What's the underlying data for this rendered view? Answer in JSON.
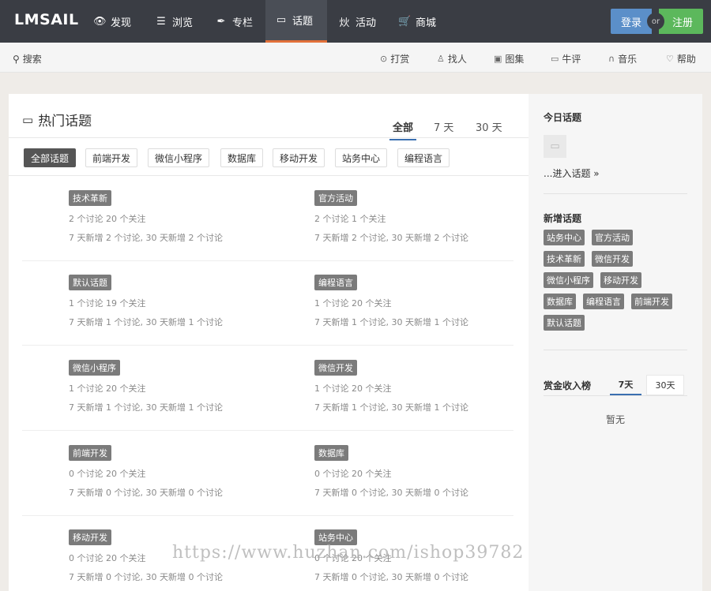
{
  "brand": "LMSAIL",
  "nav": [
    {
      "label": "发现",
      "icon": "eye-icon",
      "glyph": "👁"
    },
    {
      "label": "浏览",
      "icon": "list-icon",
      "glyph": "☰"
    },
    {
      "label": "专栏",
      "icon": "feather-icon",
      "glyph": "✒"
    },
    {
      "label": "话题",
      "icon": "chat-bubble-icon",
      "glyph": "🗨"
    },
    {
      "label": "活动",
      "icon": "activity-icon",
      "glyph": "炏"
    },
    {
      "label": "商城",
      "icon": "cart-icon",
      "glyph": "🛒"
    }
  ],
  "auth": {
    "login": "登录",
    "or": "or",
    "register": "注册"
  },
  "subnav": {
    "search": "搜索",
    "items": [
      {
        "label": "打赏",
        "icon": "coin-icon",
        "glyph": "⊙"
      },
      {
        "label": "找人",
        "icon": "user-icon",
        "glyph": "♙"
      },
      {
        "label": "图集",
        "icon": "image-icon",
        "glyph": "▣"
      },
      {
        "label": "牛评",
        "icon": "comment-icon",
        "glyph": "▭"
      },
      {
        "label": "音乐",
        "icon": "headphones-icon",
        "glyph": "∩"
      },
      {
        "label": "帮助",
        "icon": "lightbulb-icon",
        "glyph": "♡"
      }
    ]
  },
  "main": {
    "title": "热门话题",
    "range_tabs": [
      "全部",
      "7 天",
      "30 天"
    ],
    "categories": [
      "全部话题",
      "前端开发",
      "微信小程序",
      "数据库",
      "移动开发",
      "站务中心",
      "编程语言"
    ],
    "topics": [
      {
        "tag": "技术革新",
        "stats": "2 个讨论 20 个关注",
        "trend": "7 天新增 2 个讨论, 30 天新增 2 个讨论"
      },
      {
        "tag": "官方活动",
        "stats": "2 个讨论 1 个关注",
        "trend": "7 天新增 2 个讨论, 30 天新增 2 个讨论"
      },
      {
        "tag": "默认话题",
        "stats": "1 个讨论 19 个关注",
        "trend": "7 天新增 1 个讨论, 30 天新增 1 个讨论"
      },
      {
        "tag": "编程语言",
        "stats": "1 个讨论 20 个关注",
        "trend": "7 天新增 1 个讨论, 30 天新增 1 个讨论"
      },
      {
        "tag": "微信小程序",
        "stats": "1 个讨论 20 个关注",
        "trend": "7 天新增 1 个讨论, 30 天新增 1 个讨论"
      },
      {
        "tag": "微信开发",
        "stats": "1 个讨论 20 个关注",
        "trend": "7 天新增 1 个讨论, 30 天新增 1 个讨论"
      },
      {
        "tag": "前端开发",
        "stats": "0 个讨论 20 个关注",
        "trend": "7 天新增 0 个讨论, 30 天新增 0 个讨论"
      },
      {
        "tag": "数据库",
        "stats": "0 个讨论 20 个关注",
        "trend": "7 天新增 0 个讨论, 30 天新增 0 个讨论"
      },
      {
        "tag": "移动开发",
        "stats": "0 个讨论 20 个关注",
        "trend": "7 天新增 0 个讨论, 30 天新增 0 个讨论"
      },
      {
        "tag": "站务中心",
        "stats": "0 个讨论 20 个关注",
        "trend": "7 天新增 0 个讨论, 30 天新增 0 个讨论"
      }
    ]
  },
  "sidebar": {
    "today_title": "今日话题",
    "enter_link": "...进入话题 »",
    "new_title": "新增话题",
    "new_tags": [
      "站务中心",
      "官方活动",
      "技术革新",
      "微信开发",
      "微信小程序",
      "移动开发",
      "数据库",
      "编程语言",
      "前端开发",
      "默认话题"
    ],
    "rank_title": "赏金收入榜",
    "rank_tabs": [
      "7天",
      "30天"
    ],
    "empty": "暂无"
  },
  "watermark": "https://www.huzhan.com/ishop39782"
}
